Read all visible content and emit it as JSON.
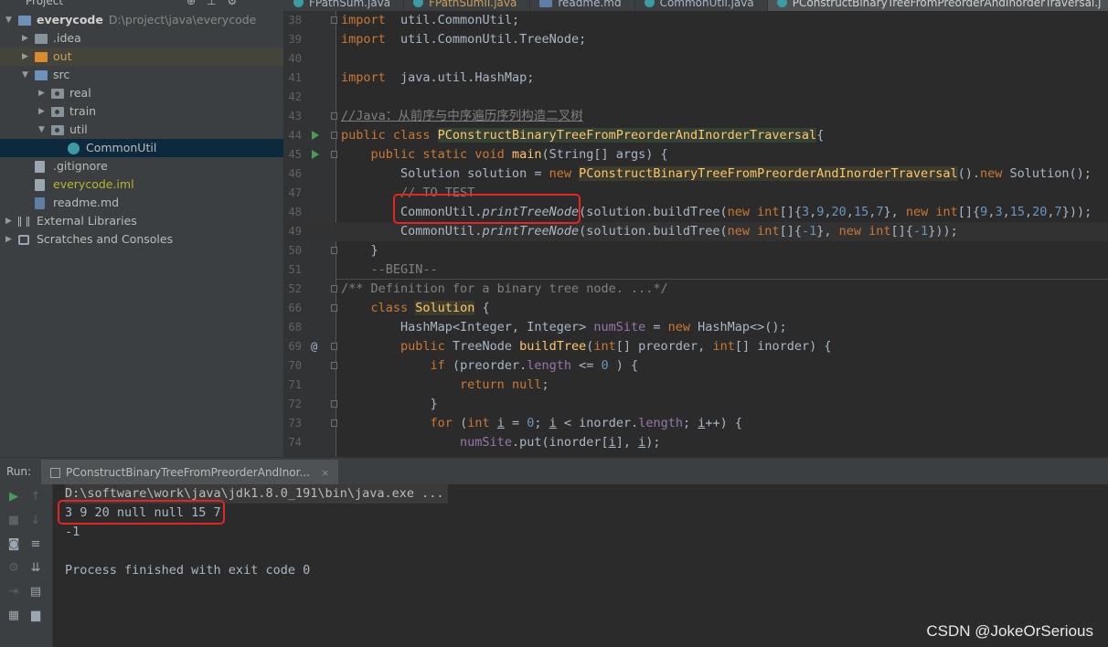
{
  "project_header": {
    "label": "Project",
    "icons": [
      "target-icon",
      "collapse-icon",
      "settings-gear-icon"
    ]
  },
  "tabs": [
    {
      "label": "FPathSum.java",
      "type": "java"
    },
    {
      "label": "FPathSumII.java",
      "type": "java",
      "style": "orange"
    },
    {
      "label": "readme.md",
      "type": "md"
    },
    {
      "label": "CommonUtil.java",
      "type": "java"
    },
    {
      "label": "PConstructBinaryTreeFromPreorderAndInorderTraversal.j",
      "type": "java",
      "active": true
    }
  ],
  "tree": [
    {
      "label": "everycode",
      "path": "D:\\project\\java\\everycode",
      "icon": "module-folder-icon",
      "arrow": "▼",
      "indent": 0
    },
    {
      "label": ".idea",
      "icon": "folder-icon",
      "arrow": "▶",
      "indent": 1
    },
    {
      "label": "out",
      "icon": "excluded-folder-icon",
      "arrow": "▶",
      "indent": 1,
      "style": "orange"
    },
    {
      "label": "src",
      "icon": "source-folder-icon",
      "arrow": "▼",
      "indent": 1
    },
    {
      "label": "real",
      "icon": "package-icon",
      "arrow": "▶",
      "indent": 2
    },
    {
      "label": "train",
      "icon": "package-icon",
      "arrow": "▶",
      "indent": 2
    },
    {
      "label": "util",
      "icon": "package-icon",
      "arrow": "▼",
      "indent": 2
    },
    {
      "label": "CommonUtil",
      "icon": "class-icon",
      "arrow": "",
      "indent": 3,
      "selected": true
    },
    {
      "label": ".gitignore",
      "icon": "file-icon",
      "arrow": "",
      "indent": 1
    },
    {
      "label": "everycode.iml",
      "icon": "file-icon",
      "arrow": "",
      "indent": 1,
      "style": "yellow"
    },
    {
      "label": "readme.md",
      "icon": "markdown-file-icon",
      "arrow": "",
      "indent": 1
    },
    {
      "label": "External Libraries",
      "icon": "library-icon",
      "arrow": "▶",
      "indent": 0
    },
    {
      "label": "Scratches and Consoles",
      "icon": "scratches-icon",
      "arrow": "▶",
      "indent": 0
    }
  ],
  "editor": {
    "lines": [
      {
        "n": "38",
        "tokens": [
          [
            "kw",
            "import"
          ],
          [
            "",
            "  util.CommonUtil;"
          ]
        ]
      },
      {
        "n": "39",
        "tokens": [
          [
            "kw",
            "import"
          ],
          [
            "",
            "  util.CommonUtil.TreeNode;"
          ]
        ]
      },
      {
        "n": "40",
        "tokens": []
      },
      {
        "n": "41",
        "tokens": [
          [
            "kw",
            "import"
          ],
          [
            "",
            "  java.util.HashMap;"
          ]
        ]
      },
      {
        "n": "42",
        "tokens": []
      },
      {
        "n": "43",
        "tokens": [
          [
            "cm-u",
            "//Java：从前序与中序遍历序列构造二叉树"
          ]
        ]
      },
      {
        "n": "44",
        "run": true,
        "tokens": [
          [
            "kw",
            "public class "
          ],
          [
            "cls-hl",
            "PConstructBinaryTreeFromPreorderAndInorderTraversal"
          ],
          [
            "",
            "{"
          ]
        ]
      },
      {
        "n": "45",
        "run": true,
        "tokens": [
          [
            "",
            "    "
          ],
          [
            "kw",
            "public static void "
          ],
          [
            "fn",
            "main"
          ],
          [
            "",
            "(String[] args) {"
          ]
        ]
      },
      {
        "n": "46",
        "tokens": [
          [
            "",
            "        Solution solution = "
          ],
          [
            "kw",
            "new "
          ],
          [
            "cls-hl2",
            "PConstructBinaryTreeFromPreorderAndInorderTraversal"
          ],
          [
            "",
            "()."
          ],
          [
            "kw",
            "new "
          ],
          [
            "",
            "Solution();"
          ]
        ]
      },
      {
        "n": "47",
        "tokens": [
          [
            "",
            "        "
          ],
          [
            "cm",
            "// TO TEST"
          ]
        ]
      },
      {
        "n": "48",
        "tokens": [
          [
            "",
            "        CommonUtil."
          ],
          [
            "it",
            "printTreeNode"
          ],
          [
            "",
            "(solution.buildTree("
          ],
          [
            "kw",
            "new int"
          ],
          [
            "",
            "[]{"
          ],
          [
            "num",
            "3"
          ],
          [
            "",
            ","
          ],
          [
            "num",
            "9"
          ],
          [
            "",
            ","
          ],
          [
            "num",
            "20"
          ],
          [
            "",
            ","
          ],
          [
            "num",
            "15"
          ],
          [
            "",
            ","
          ],
          [
            "num",
            "7"
          ],
          [
            "",
            "}, "
          ],
          [
            "kw",
            "new int"
          ],
          [
            "",
            "[]{"
          ],
          [
            "num",
            "9"
          ],
          [
            "",
            ","
          ],
          [
            "num",
            "3"
          ],
          [
            "",
            ","
          ],
          [
            "num",
            "15"
          ],
          [
            "",
            ","
          ],
          [
            "num",
            "20"
          ],
          [
            "",
            ","
          ],
          [
            "num",
            "7"
          ],
          [
            "",
            "}));"
          ]
        ]
      },
      {
        "n": "49",
        "caret": true,
        "tokens": [
          [
            "",
            "        CommonUtil."
          ],
          [
            "it",
            "printTreeNode"
          ],
          [
            "",
            "(solution.buildTree("
          ],
          [
            "kw",
            "new int"
          ],
          [
            "",
            "[]{"
          ],
          [
            "num",
            "-1"
          ],
          [
            "",
            "}, "
          ],
          [
            "kw",
            "new int"
          ],
          [
            "",
            "[]{"
          ],
          [
            "num",
            "-1"
          ],
          [
            "",
            "}));"
          ]
        ]
      },
      {
        "n": "50",
        "tokens": [
          [
            "",
            "    }"
          ]
        ]
      },
      {
        "n": "51",
        "tokens": [
          [
            "",
            "    "
          ],
          [
            "cm",
            "--BEGIN--"
          ]
        ]
      },
      {
        "n": "52",
        "sep": true,
        "tokens": [
          [
            "cm",
            "/** Definition for a binary tree node. ...*/"
          ]
        ]
      },
      {
        "n": "66",
        "tokens": [
          [
            "",
            "    "
          ],
          [
            "kw",
            "class "
          ],
          [
            "cls-hl2",
            "Solution"
          ],
          [
            "",
            " {"
          ]
        ]
      },
      {
        "n": "68",
        "tokens": [
          [
            "",
            "        HashMap<Integer, Integer> "
          ],
          [
            "field",
            "numSite"
          ],
          [
            "",
            " = "
          ],
          [
            "kw",
            "new "
          ],
          [
            "",
            "HashMap<>();"
          ]
        ]
      },
      {
        "n": "69",
        "at": true,
        "tokens": [
          [
            "",
            "        "
          ],
          [
            "kw",
            "public "
          ],
          [
            "",
            "TreeNode "
          ],
          [
            "fn",
            "buildTree"
          ],
          [
            "",
            "("
          ],
          [
            "kw",
            "int"
          ],
          [
            "",
            "[] preorder, "
          ],
          [
            "kw",
            "int"
          ],
          [
            "",
            "[] inorder) {"
          ]
        ]
      },
      {
        "n": "70",
        "tokens": [
          [
            "",
            "            "
          ],
          [
            "kw",
            "if "
          ],
          [
            "",
            "(preorder."
          ],
          [
            "field",
            "length"
          ],
          [
            "",
            " <= "
          ],
          [
            "num",
            "0"
          ],
          [
            "",
            " ) {"
          ]
        ]
      },
      {
        "n": "71",
        "tokens": [
          [
            "",
            "                "
          ],
          [
            "kw",
            "return null"
          ],
          [
            "",
            ";"
          ]
        ]
      },
      {
        "n": "72",
        "tokens": [
          [
            "",
            "            }"
          ]
        ]
      },
      {
        "n": "73",
        "tokens": [
          [
            "",
            "            "
          ],
          [
            "kw",
            "for "
          ],
          [
            "",
            "("
          ],
          [
            "kw",
            "int "
          ],
          [
            "uvar",
            "i"
          ],
          [
            "",
            " = "
          ],
          [
            "num",
            "0"
          ],
          [
            "",
            "; "
          ],
          [
            "uvar",
            "i"
          ],
          [
            "",
            " < inorder."
          ],
          [
            "field",
            "length"
          ],
          [
            "",
            "; "
          ],
          [
            "uvar",
            "i"
          ],
          [
            "",
            "++) {"
          ]
        ]
      },
      {
        "n": "74",
        "tokens": [
          [
            "",
            "                "
          ],
          [
            "field",
            "numSite"
          ],
          [
            "",
            ".put(inorder["
          ],
          [
            "uvar",
            "i"
          ],
          [
            "",
            "], "
          ],
          [
            "uvar",
            "i"
          ],
          [
            "",
            ");"
          ]
        ]
      }
    ]
  },
  "run": {
    "label": "Run:",
    "tab_title": "PConstructBinaryTreeFromPreorderAndInor...",
    "tab_close": "×",
    "toolbar_icons": [
      "rerun-icon",
      "scroll-up-icon",
      "stop-icon",
      "scroll-down-icon",
      "camera-icon",
      "soft-wrap-icon",
      "settings-icon",
      "scroll-to-end-icon",
      "exit-icon",
      "print-icon",
      "layout-icon",
      "trash-icon"
    ],
    "console": [
      {
        "text": "D:\\software\\work\\java\\jdk1.8.0_191\\bin\\java.exe ...",
        "style": "cmd"
      },
      {
        "text": "3 9 20 null null 15 7"
      },
      {
        "text": "-1"
      },
      {
        "text": ""
      },
      {
        "text": "Process finished with exit code 0"
      }
    ]
  },
  "watermark": "CSDN @JokeOrSerious",
  "colors": {
    "keyword": "#cc7832",
    "number": "#6897bb",
    "comment": "#808080",
    "function": "#ffc66d",
    "annotation_box": "#e5251f"
  }
}
